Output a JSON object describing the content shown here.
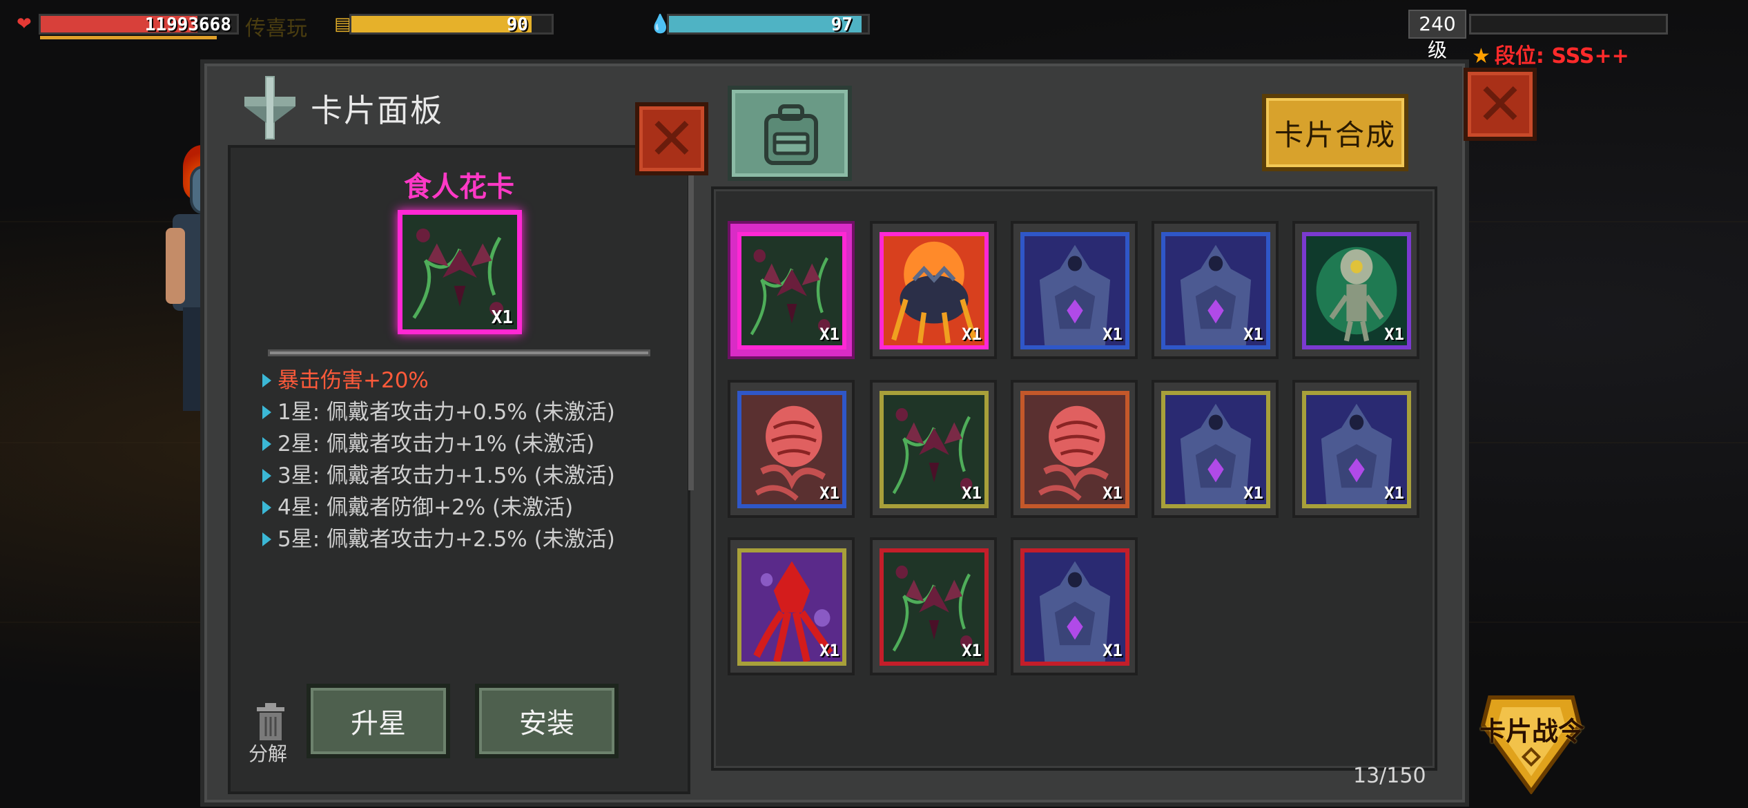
{
  "hud": {
    "hp_value": "11993668",
    "hp_fraction": 0.8,
    "player_name": "传喜玩",
    "energy_value": "90",
    "energy_fraction": 0.9,
    "water_value": "97",
    "water_fraction": 0.97,
    "level_label": "240级",
    "level_fraction": 0.0,
    "rank_label": "段位: SSS++",
    "colors": {
      "hp": "#d8403a",
      "energy": "#e6b12a",
      "water": "#4fb3c4",
      "rank": "#ff2a2a"
    }
  },
  "panel": {
    "title": "卡片面板",
    "synth_button": "卡片合成",
    "icons": [
      "card-panel-icon",
      "backpack-icon",
      "close-icon",
      "trash-icon"
    ]
  },
  "detail": {
    "card_name": "食人花卡",
    "card_qty": "X1",
    "card_color": "#ff28d4",
    "stats": [
      {
        "text": "暴击伤害+20%",
        "highlight": true
      },
      {
        "text": "1星: 佩戴者攻击力+0.5% (未激活)",
        "highlight": false
      },
      {
        "text": "2星: 佩戴者攻击力+1% (未激活)",
        "highlight": false
      },
      {
        "text": "3星: 佩戴者攻击力+1.5% (未激活)",
        "highlight": false
      },
      {
        "text": "4星: 佩戴者防御+2% (未激活)",
        "highlight": false
      },
      {
        "text": "5星: 佩戴者攻击力+2.5% (未激活)",
        "highlight": false
      }
    ],
    "upgrade_button": "升星",
    "install_button": "安装",
    "decompose_label": "分解"
  },
  "cards": [
    {
      "art": "man-eating-flower",
      "border": "#ff28d4",
      "qty": "X1",
      "selected": true
    },
    {
      "art": "fire-beetle",
      "border": "#ff28d4",
      "qty": "X1",
      "selected": false
    },
    {
      "art": "stone-golem",
      "border": "#2f57c8",
      "qty": "X1",
      "selected": false
    },
    {
      "art": "stone-golem",
      "border": "#2f57c8",
      "qty": "X1",
      "selected": false
    },
    {
      "art": "alien-robot",
      "border": "#7a3ad0",
      "qty": "X1",
      "selected": false
    },
    {
      "art": "flesh-brain",
      "border": "#2f57c8",
      "qty": "X1",
      "selected": false
    },
    {
      "art": "man-eating-flower",
      "border": "#a8a03a",
      "qty": "X1",
      "selected": false
    },
    {
      "art": "flesh-brain",
      "border": "#c4582a",
      "qty": "X1",
      "selected": false
    },
    {
      "art": "stone-golem",
      "border": "#a8a03a",
      "qty": "X1",
      "selected": false
    },
    {
      "art": "stone-golem",
      "border": "#a8a03a",
      "qty": "X1",
      "selected": false
    },
    {
      "art": "red-squid",
      "border": "#a8a03a",
      "qty": "X1",
      "selected": false
    },
    {
      "art": "man-eating-flower",
      "border": "#c41e2a",
      "qty": "X1",
      "selected": false
    },
    {
      "art": "stone-golem",
      "border": "#c41e2a",
      "qty": "X1",
      "selected": false
    }
  ],
  "inventory_count": "13/150",
  "battle_pass_label": "卡片战令"
}
